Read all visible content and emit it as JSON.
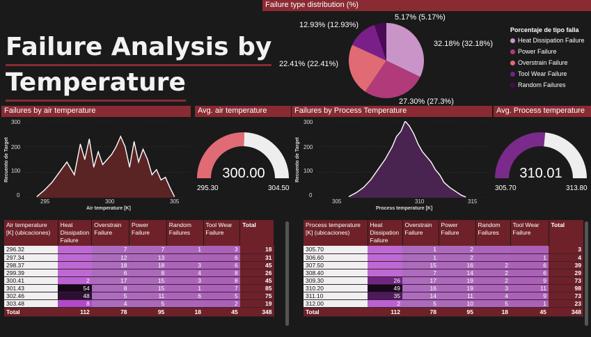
{
  "title": {
    "line1": "Failure Analysis by",
    "line2": "Temperature"
  },
  "pie": {
    "header": "Failure type distribution (%)",
    "legend_title": "Porcentaje de  tipo falla",
    "slices": [
      {
        "name": "Heat Dissipation Failure",
        "value": 32.18,
        "label": "32.18% (32.18%)",
        "color": "#c994c7"
      },
      {
        "name": "Power Failure",
        "value": 27.3,
        "label": "27.30% (27.3%)",
        "color": "#b03a7a"
      },
      {
        "name": "Overstrain Failure",
        "value": 22.41,
        "label": "22.41% (22.41%)",
        "color": "#e06b74"
      },
      {
        "name": "Tool Wear Failure",
        "value": 12.93,
        "label": "12.93% (12.93%)",
        "color": "#7a1f8a"
      },
      {
        "name": "Random Failures",
        "value": 5.17,
        "label": "5.17% (5.17%)",
        "color": "#4a0a55"
      }
    ]
  },
  "air_chart": {
    "header": "Failures by air temperature",
    "ylabel": "Recuento de Target",
    "xlabel": "Air temperature [K]",
    "yticks": [
      "300",
      "200",
      "100",
      "0"
    ],
    "xticks": [
      "295",
      "300",
      "305"
    ]
  },
  "air_gauge": {
    "header": "Avg. air temperature",
    "value": "300.00",
    "min": "295.30",
    "max": "304.50",
    "fraction": 0.51,
    "color": "#e06b74"
  },
  "proc_chart": {
    "header": "Failures by Process Temperature",
    "ylabel": "Recuento de Target",
    "xlabel": "Process temperature [K]",
    "yticks": [
      "300",
      "200",
      "100",
      "0"
    ],
    "xticks": [
      "305",
      "310",
      "315"
    ]
  },
  "proc_gauge": {
    "header": "Avg. Process temperature",
    "value": "310.01",
    "min": "305.70",
    "max": "313.80",
    "fraction": 0.53,
    "color": "#7a2a8a"
  },
  "chart_data": [
    {
      "type": "pie",
      "title": "Failure type distribution (%)",
      "categories": [
        "Heat Dissipation Failure",
        "Power Failure",
        "Overstrain Failure",
        "Tool Wear Failure",
        "Random Failures"
      ],
      "values": [
        32.18,
        27.3,
        22.41,
        12.93,
        5.17
      ]
    },
    {
      "type": "area",
      "title": "Failures by air temperature",
      "xlabel": "Air temperature [K]",
      "ylabel": "Recuento de Target",
      "xlim": [
        294.5,
        305.5
      ],
      "ylim": [
        0,
        300
      ],
      "x": [
        295.3,
        295.8,
        296.3,
        296.8,
        297.3,
        297.8,
        298.2,
        298.5,
        298.8,
        299.1,
        299.4,
        299.7,
        300.0,
        300.3,
        300.6,
        300.9,
        301.2,
        301.5,
        301.8,
        302.1,
        302.4,
        302.7,
        303.0,
        303.3,
        303.6,
        303.9,
        304.2,
        304.5
      ],
      "y": [
        5,
        30,
        60,
        100,
        140,
        90,
        210,
        150,
        230,
        120,
        180,
        130,
        150,
        170,
        200,
        240,
        200,
        120,
        220,
        140,
        190,
        150,
        90,
        110,
        70,
        80,
        40,
        5
      ]
    },
    {
      "type": "area",
      "title": "Failures by Process Temperature",
      "xlabel": "Process temperature [K]",
      "ylabel": "Recuento de Target",
      "xlim": [
        303.5,
        315.5
      ],
      "ylim": [
        0,
        300
      ],
      "x": [
        305.7,
        306.2,
        306.7,
        307.2,
        307.7,
        308.2,
        308.7,
        309.0,
        309.3,
        309.6,
        309.9,
        310.2,
        310.5,
        310.8,
        311.1,
        311.4,
        311.7,
        312.0,
        312.3,
        312.7,
        313.1,
        313.5,
        313.8
      ],
      "y": [
        5,
        20,
        40,
        70,
        110,
        150,
        200,
        240,
        260,
        300,
        280,
        250,
        210,
        180,
        160,
        140,
        110,
        90,
        60,
        40,
        25,
        10,
        3
      ]
    }
  ],
  "air_table": {
    "headers": [
      "Air temperature [K] (ubicaciones)",
      "Heat Dissipation Failure",
      "Overstrain Failure",
      "Power Failure",
      "Random Failures",
      "Tool Wear Failure",
      "Total"
    ],
    "rows": [
      [
        "296.32",
        "",
        "7",
        "7",
        "1",
        "3",
        "18"
      ],
      [
        "297.34",
        "",
        "12",
        "13",
        "",
        "6",
        "31"
      ],
      [
        "298.37",
        "",
        "18",
        "18",
        "3",
        "6",
        "45"
      ],
      [
        "299.39",
        "",
        "6",
        "8",
        "4",
        "8",
        "26"
      ],
      [
        "300.41",
        "2",
        "17",
        "15",
        "3",
        "8",
        "45"
      ],
      [
        "301.43",
        "54",
        "8",
        "15",
        "1",
        "7",
        "85"
      ],
      [
        "302.46",
        "48",
        "5",
        "11",
        "6",
        "5",
        "75"
      ],
      [
        "303.48",
        "8",
        "4",
        "5",
        "",
        "2",
        "19"
      ]
    ],
    "total": [
      "Total",
      "112",
      "78",
      "95",
      "18",
      "45",
      "348"
    ]
  },
  "proc_table": {
    "headers": [
      "Process temperature [K] (ubicaciones)",
      "Heat Dissipation Failure",
      "Overstrain Failure",
      "Power Failure",
      "Random Failures",
      "Tool Wear Failure",
      "Total"
    ],
    "rows": [
      [
        "305.70",
        "",
        "1",
        "2",
        "",
        "",
        "3"
      ],
      [
        "306.60",
        "",
        "1",
        "2",
        "",
        "1",
        "4"
      ],
      [
        "307.50",
        "",
        "15",
        "16",
        "2",
        "6",
        "39"
      ],
      [
        "308.40",
        "",
        "7",
        "14",
        "2",
        "6",
        "29"
      ],
      [
        "309.30",
        "26",
        "17",
        "19",
        "2",
        "9",
        "73"
      ],
      [
        "310.20",
        "49",
        "16",
        "19",
        "3",
        "11",
        "98"
      ],
      [
        "311.10",
        "35",
        "14",
        "11",
        "4",
        "9",
        "73"
      ],
      [
        "312.00",
        "2",
        "5",
        "10",
        "5",
        "1",
        "23"
      ]
    ],
    "total": [
      "Total",
      "112",
      "78",
      "95",
      "18",
      "45",
      "348"
    ]
  }
}
